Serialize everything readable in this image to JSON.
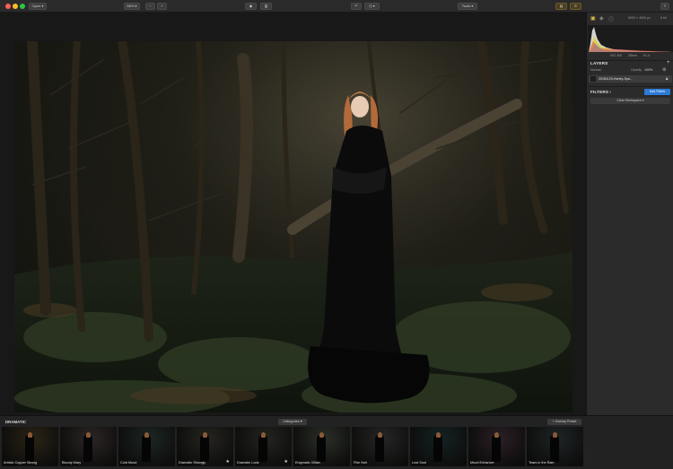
{
  "toolbar": {
    "open_label": "Open",
    "zoom_label": "56%",
    "zoom_out_label": "−",
    "zoom_in_label": "+",
    "tools_label": "Tools"
  },
  "panel": {
    "image_size": "6000 × 4000 px",
    "bit_depth": "8 bit",
    "exif": [
      "ISO 400",
      "35mm",
      "f/1.4"
    ],
    "layers_title": "LAYERS",
    "blend_mode": "Normal",
    "opacity_label": "Opacity",
    "opacity_value": "100%",
    "layer_name": "20181129-Harley-Spa...",
    "filters_title": "FILTERS",
    "add_filters_label": "Add Filters",
    "clear_workspace_label": "Clear Workspace"
  },
  "presets": {
    "category_title": "DRAMATIC",
    "categories_label": "Categories",
    "overlay_label": "+ Overlay Preset",
    "items": [
      {
        "label": "Artistic Copper Strong",
        "tint": "#2b2416",
        "star": false
      },
      {
        "label": "Bloody Mary",
        "tint": "#2c2626",
        "star": false
      },
      {
        "label": "Cold Mood",
        "tint": "#1d2624",
        "star": false
      },
      {
        "label": "Dramatic Strongly",
        "tint": "#252420",
        "star": true
      },
      {
        "label": "Dramatic Look",
        "tint": "#23231f",
        "star": true
      },
      {
        "label": "Enigmatic Villain",
        "tint": "#2b2f28",
        "star": false
      },
      {
        "label": "Film Noir",
        "tint": "#262626",
        "star": false
      },
      {
        "label": "Lost Soul",
        "tint": "#152223",
        "star": false
      },
      {
        "label": "Mood Enhancer",
        "tint": "#2a1f26",
        "star": false
      },
      {
        "label": "Tears in the Rain",
        "tint": "#1f2426",
        "star": false
      }
    ]
  },
  "colors": {
    "accent": "#2d7bd6",
    "panel_bg": "#2b2b2b",
    "toolbar_bg": "#2a2a2a"
  },
  "icons": [
    "histogram-icon",
    "layers-icon",
    "info-icon",
    "compare-icon",
    "undo-icon",
    "history-icon",
    "share-icon"
  ]
}
